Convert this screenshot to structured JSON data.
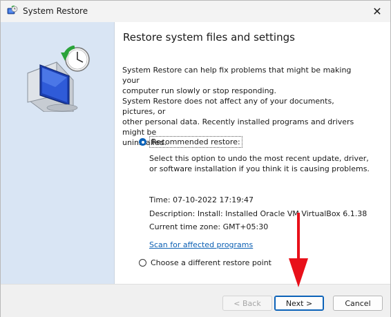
{
  "window": {
    "title": "System Restore",
    "close_glyph": "✕"
  },
  "content": {
    "heading": "Restore system files and settings",
    "para1_line1": "System Restore can help fix problems that might be making your",
    "para1_line2": "computer run slowly or stop responding.",
    "para2_line1": "System Restore does not affect any of your documents, pictures, or",
    "para2_line2": "other personal data. Recently installed programs and drivers might be",
    "para2_line3": "uninstalled.",
    "recommended_label": "Recommended restore:",
    "recommended_desc_line1": "Select this option to undo the most recent update, driver,",
    "recommended_desc_line2": "or software installation if you think it is causing problems.",
    "time": "Time: 07-10-2022 17:19:47",
    "description": "Description: Install: Installed Oracle VM VirtualBox 6.1.38",
    "timezone": "Current time zone: GMT+05:30",
    "scan_link": "Scan for affected programs",
    "choose_label": "Choose a different restore point"
  },
  "footer": {
    "back_label": "< Back",
    "next_label": "Next >",
    "cancel_label": "Cancel"
  },
  "colors": {
    "accent": "#0b62b8",
    "arrow": "#e8101a",
    "left_pane": "#d9e5f4"
  },
  "icons": {
    "app": "system-restore-icon",
    "hero": "system-restore-illustration",
    "annotation": "red-down-arrow"
  }
}
